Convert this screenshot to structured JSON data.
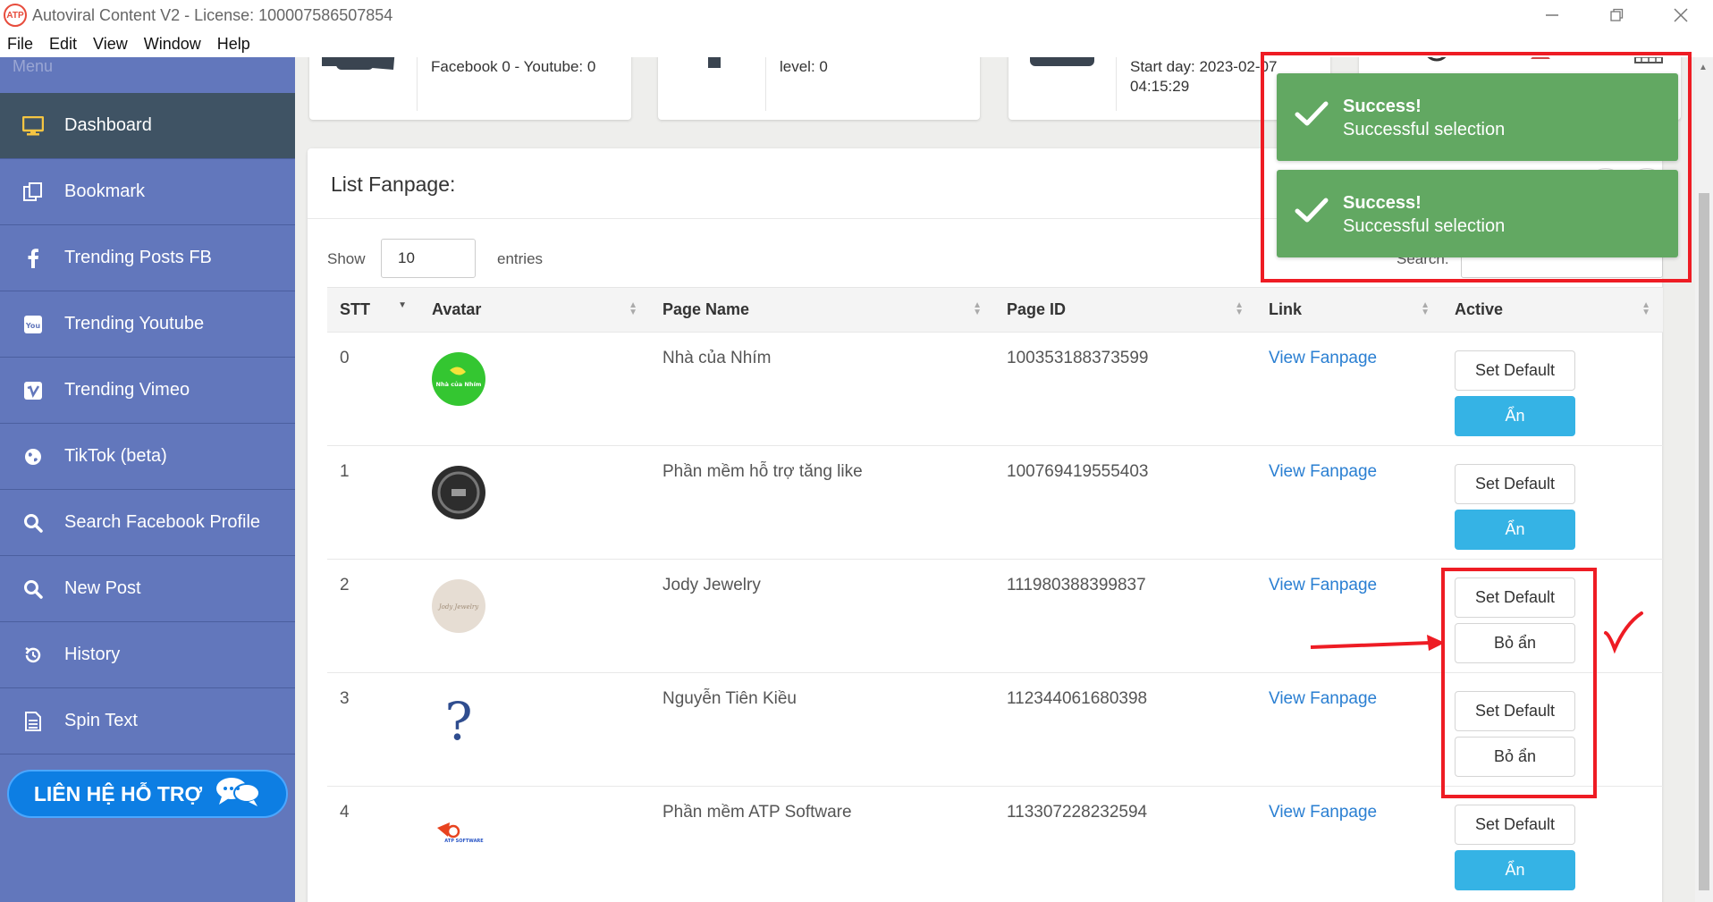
{
  "window": {
    "title": "Autoviral Content V2 - License: 100007586507854",
    "logo_text": "ATP"
  },
  "menubar": [
    "File",
    "Edit",
    "View",
    "Window",
    "Help"
  ],
  "sidebar": {
    "menu_label": "Menu",
    "items": [
      {
        "label": "Dashboard",
        "icon": "monitor-icon",
        "active": true
      },
      {
        "label": "Bookmark",
        "icon": "bookmark-icon"
      },
      {
        "label": "Trending Posts FB",
        "icon": "facebook-icon"
      },
      {
        "label": "Trending Youtube",
        "icon": "youtube-icon"
      },
      {
        "label": "Trending Vimeo",
        "icon": "vimeo-icon"
      },
      {
        "label": "TikTok (beta)",
        "icon": "globe-icon"
      },
      {
        "label": "Search Facebook Profile",
        "icon": "search-icon"
      },
      {
        "label": "New Post",
        "icon": "search-icon"
      },
      {
        "label": "History",
        "icon": "history-icon"
      },
      {
        "label": "Spin Text",
        "icon": "document-icon"
      }
    ],
    "support_label": "LIÊN HỆ HỖ TRỢ"
  },
  "stats": {
    "card1": "Facebook 0 - Youtube: 0",
    "card2": "level: 0",
    "card3_line1": "Start day: 2023-02-07",
    "card3_line2": "04:15:29"
  },
  "panel": {
    "title": "List Fanpage:",
    "show_label": "Show",
    "entries_value": "10",
    "entries_label": "entries",
    "search_label": "Search:",
    "search_value": ""
  },
  "table": {
    "headers": [
      "STT",
      "Avatar",
      "Page Name",
      "Page ID",
      "Link",
      "Active"
    ],
    "rows": [
      {
        "stt": "0",
        "name": "Nhà của Nhím",
        "page_id": "100353188373599",
        "link": "View Fanpage",
        "btn1": "Set Default",
        "btn2": "Ẩn",
        "hidden": false,
        "avatar_text": "Nhà của Nhím"
      },
      {
        "stt": "1",
        "name": "Phần mềm hỗ trợ tăng like",
        "page_id": "100769419555403",
        "link": "View Fanpage",
        "btn1": "Set Default",
        "btn2": "Ẩn",
        "hidden": false,
        "avatar_text": ""
      },
      {
        "stt": "2",
        "name": "Jody Jewelry",
        "page_id": "111980388399837",
        "link": "View Fanpage",
        "btn1": "Set Default",
        "btn2": "Bỏ ẩn",
        "hidden": true,
        "avatar_text": "Jody Jewelry"
      },
      {
        "stt": "3",
        "name": "Nguyễn Tiên Kiều",
        "page_id": "112344061680398",
        "link": "View Fanpage",
        "btn1": "Set Default",
        "btn2": "Bỏ ẩn",
        "hidden": true,
        "avatar_text": "?"
      },
      {
        "stt": "4",
        "name": "Phần mềm ATP Software",
        "page_id": "113307228232594",
        "link": "View Fanpage",
        "btn1": "Set Default",
        "btn2": "Ẩn",
        "hidden": false,
        "avatar_text": "ATP SOFTWARE"
      }
    ]
  },
  "toasts": [
    {
      "title": "Success!",
      "message": "Successful selection"
    },
    {
      "title": "Success!",
      "message": "Successful selection"
    }
  ],
  "colors": {
    "sidebar": "#6277bc",
    "sidebar_active": "#3f5364",
    "toast": "#62a862",
    "annotation": "#ee1c24",
    "button_blue": "#35b3e5",
    "link": "#2a7fd2"
  }
}
